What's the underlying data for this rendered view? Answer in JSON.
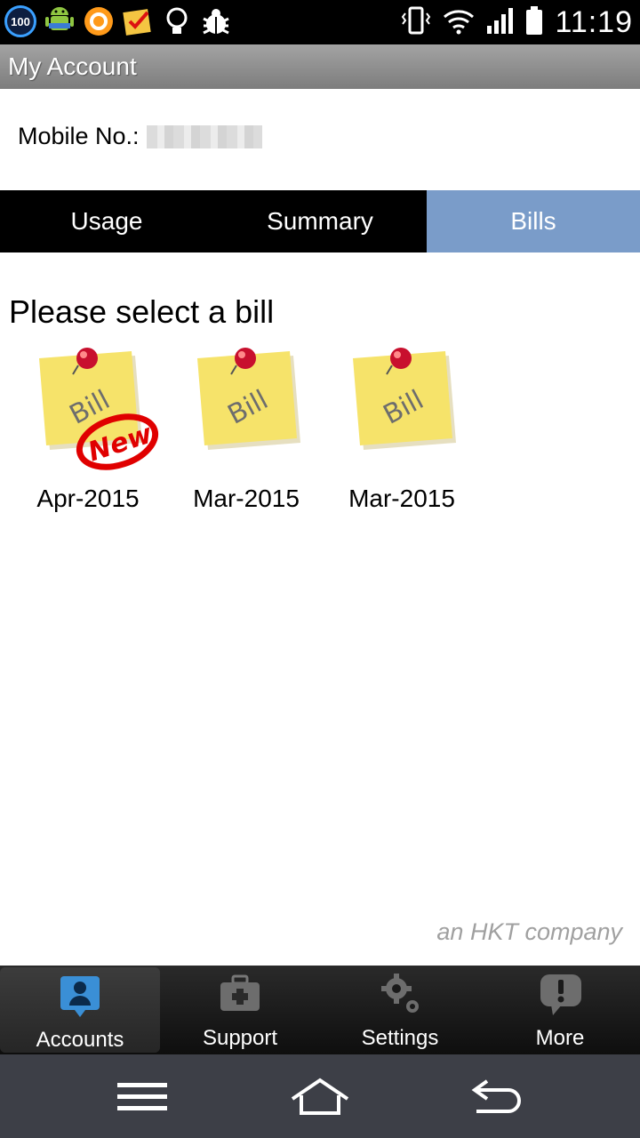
{
  "status_bar": {
    "time": "11:19",
    "badge": "100",
    "icons": [
      "battery-saver-badge-icon",
      "android-icon",
      "orange-ring-icon",
      "task-checklist-icon",
      "lightbulb-icon",
      "bug-icon",
      "vibrate-icon",
      "wifi-icon",
      "signal-icon",
      "battery-icon"
    ]
  },
  "header": {
    "title": "My Account"
  },
  "account": {
    "mobile_label": "Mobile No.:"
  },
  "tabs": [
    {
      "label": "Usage",
      "active": false
    },
    {
      "label": "Summary",
      "active": false
    },
    {
      "label": "Bills",
      "active": true
    }
  ],
  "main": {
    "prompt": "Please select a bill",
    "bills": [
      {
        "label": "Apr-2015",
        "note_text": "Bill",
        "new": true,
        "new_text": "New"
      },
      {
        "label": "Mar-2015",
        "note_text": "Bill",
        "new": false
      },
      {
        "label": "Mar-2015",
        "note_text": "Bill",
        "new": false
      }
    ],
    "footer": "an HKT company"
  },
  "bottom_nav": [
    {
      "label": "Accounts",
      "icon": "person-icon",
      "active": true
    },
    {
      "label": "Support",
      "icon": "first-aid-kit-icon",
      "active": false
    },
    {
      "label": "Settings",
      "icon": "gears-icon",
      "active": false
    },
    {
      "label": "More",
      "icon": "exclamation-bubble-icon",
      "active": false
    }
  ],
  "system_nav": [
    "menu-icon",
    "home-icon",
    "back-icon"
  ],
  "colors": {
    "active_tab": "#7a9cc9",
    "note_yellow": "#f6e36a",
    "pin_red": "#c8102e",
    "accent_blue": "#3a8fd6"
  }
}
